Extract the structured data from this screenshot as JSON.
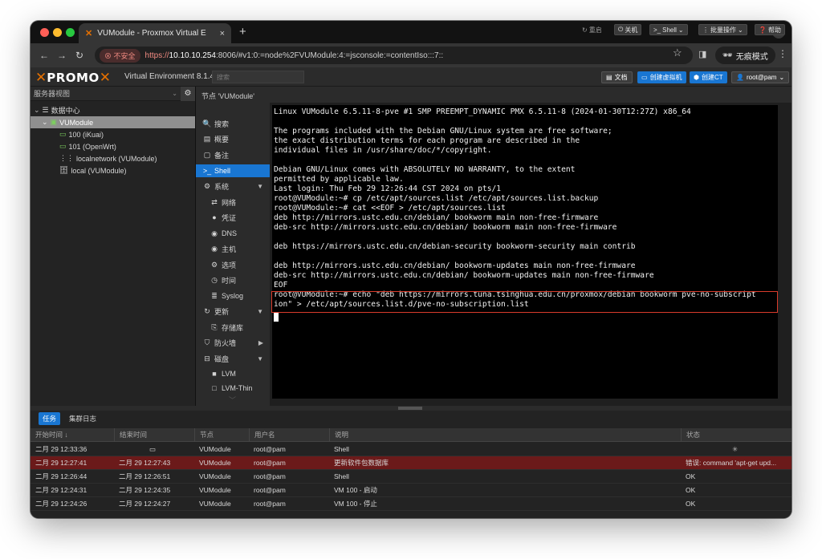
{
  "browser": {
    "tab_title": "VUModule - Proxmox Virtual E",
    "new_tab": "+",
    "insecure_label": "不安全",
    "url_scheme": "https://",
    "url_host": "10.10.10.254",
    "url_rest": ":8006/#v1:0:=node%2FVUModule:4:=jsconsole:=contentIso:::7::",
    "incognito_label": "无痕模式"
  },
  "pve": {
    "logo_text_1": "PRO",
    "logo_text_2": "MO",
    "version": "Virtual Environment 8.1.4",
    "search_placeholder": "搜索",
    "header_buttons": {
      "docs": "文档",
      "create_vm": "创建虚拟机",
      "create_ct": "创建CT",
      "user": "root@pam"
    }
  },
  "tree": {
    "view": "服务器视图",
    "items": [
      {
        "label": "数据中心"
      },
      {
        "label": "VUModule"
      },
      {
        "label": "100 (iKuai)"
      },
      {
        "label": "101 (OpenWrt)"
      },
      {
        "label": "localnetwork (VUModule)"
      },
      {
        "label": "local (VUModule)"
      }
    ]
  },
  "breadcrumb": "节点 'VUModule'",
  "nav": {
    "items": [
      {
        "label": "搜索"
      },
      {
        "label": "概要"
      },
      {
        "label": "备注"
      },
      {
        "label": "Shell"
      },
      {
        "label": "系统"
      },
      {
        "label": "网络"
      },
      {
        "label": "凭证"
      },
      {
        "label": "DNS"
      },
      {
        "label": "主机"
      },
      {
        "label": "选项"
      },
      {
        "label": "时间"
      },
      {
        "label": "Syslog"
      },
      {
        "label": "更新"
      },
      {
        "label": "存储库"
      },
      {
        "label": "防火墙"
      },
      {
        "label": "磁盘"
      },
      {
        "label": "LVM"
      },
      {
        "label": "LVM-Thin"
      }
    ]
  },
  "content_toolbar": {
    "restart": "重启",
    "shutdown": "关机",
    "shell": "Shell",
    "bulk": "批量操作",
    "help": "帮助"
  },
  "terminal": {
    "lines": [
      "Linux VUModule 6.5.11-8-pve #1 SMP PREEMPT_DYNAMIC PMX 6.5.11-8 (2024-01-30T12:27Z) x86_64",
      "",
      "The programs included with the Debian GNU/Linux system are free software;",
      "the exact distribution terms for each program are described in the",
      "individual files in /usr/share/doc/*/copyright.",
      "",
      "Debian GNU/Linux comes with ABSOLUTELY NO WARRANTY, to the extent",
      "permitted by applicable law.",
      "Last login: Thu Feb 29 12:26:44 CST 2024 on pts/1",
      "root@VUModule:~# cp /etc/apt/sources.list /etc/apt/sources.list.backup",
      "root@VUModule:~# cat <<EOF > /etc/apt/sources.list",
      "deb http://mirrors.ustc.edu.cn/debian/ bookworm main non-free-firmware",
      "deb-src http://mirrors.ustc.edu.cn/debian/ bookworm main non-free-firmware",
      "",
      "deb https://mirrors.ustc.edu.cn/debian-security bookworm-security main contrib",
      "",
      "deb http://mirrors.ustc.edu.cn/debian/ bookworm-updates main non-free-firmware",
      "deb-src http://mirrors.ustc.edu.cn/debian/ bookworm-updates main non-free-firmware",
      "EOF",
      "root@VUModule:~# echo \"deb https://mirrors.tuna.tsinghua.edu.cn/proxmox/debian bookworm pve-no-subscript",
      "ion\" > /etc/apt/sources.list.d/pve-no-subscription.list"
    ]
  },
  "tasks": {
    "tabs": [
      "任务",
      "集群日志"
    ],
    "columns": [
      "开始时间 ↓",
      "结束时间",
      "节点",
      "用户名",
      "说明",
      "状态"
    ],
    "rows": [
      {
        "start": "二月 29 12:33:36",
        "end": "",
        "node": "VUModule",
        "user": "root@pam",
        "desc": "Shell",
        "status": ""
      },
      {
        "start": "二月 29 12:27:41",
        "end": "二月 29 12:27:43",
        "node": "VUModule",
        "user": "root@pam",
        "desc": "更新软件包数据库",
        "status": "错误: command 'apt-get upd..."
      },
      {
        "start": "二月 29 12:26:44",
        "end": "二月 29 12:26:51",
        "node": "VUModule",
        "user": "root@pam",
        "desc": "Shell",
        "status": "OK"
      },
      {
        "start": "二月 29 12:24:31",
        "end": "二月 29 12:24:35",
        "node": "VUModule",
        "user": "root@pam",
        "desc": "VM 100 - 启动",
        "status": "OK"
      },
      {
        "start": "二月 29 12:24:26",
        "end": "二月 29 12:24:27",
        "node": "VUModule",
        "user": "root@pam",
        "desc": "VM 100 - 停止",
        "status": "OK"
      }
    ]
  }
}
